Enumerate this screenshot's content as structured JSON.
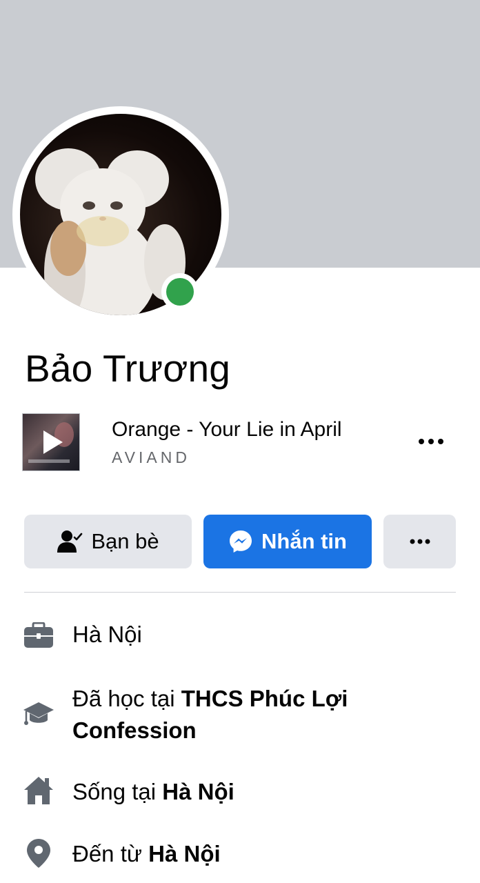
{
  "profile": {
    "name": "Bảo Trương",
    "online": true
  },
  "music": {
    "title": "Orange - Your Lie in April",
    "artist": "AVIAND",
    "more_icon": "more-horizontal-icon"
  },
  "actions": {
    "friends_label": "Bạn bè",
    "friends_icon": "friend-check-icon",
    "message_label": "Nhắn tin",
    "message_icon": "messenger-icon",
    "more_icon": "more-horizontal-icon"
  },
  "details": {
    "work": "Hà Nội",
    "education_prefix": "Đã học tại ",
    "education_place": "THCS Phúc Lợi Confession",
    "lives_prefix": "Sống tại ",
    "lives_place": "Hà Nội",
    "from_prefix": "Đến từ ",
    "from_place": "Hà Nội"
  },
  "colors": {
    "accent": "#1b74e4",
    "online": "#31a24c",
    "cover": "#c9ccd1",
    "button_secondary": "#e4e6eb",
    "icon_gray": "#606770"
  }
}
